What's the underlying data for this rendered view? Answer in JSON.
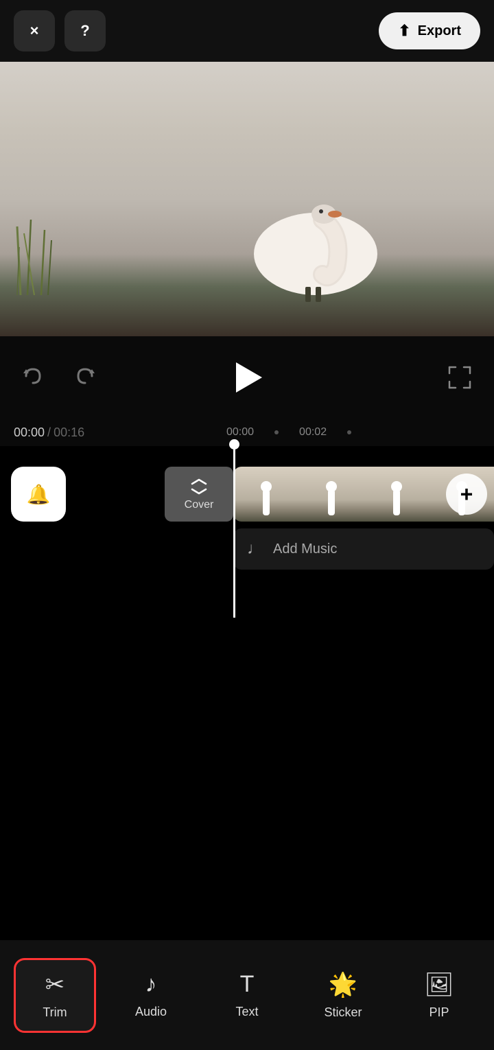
{
  "header": {
    "close_label": "×",
    "help_label": "?",
    "export_label": "Export"
  },
  "controls": {
    "undo_label": "↺",
    "redo_label": "↻",
    "play_label": "▶",
    "fullscreen_label": "⛶"
  },
  "timeline": {
    "current_time": "00:00",
    "total_time": "00:16",
    "marker_0": "00:00",
    "marker_2": "00:02",
    "cover_label": "Cover",
    "add_music_label": "Add Music",
    "add_clip_label": "+"
  },
  "toolbar": {
    "trim_label": "Trim",
    "audio_label": "Audio",
    "text_label": "Text",
    "sticker_label": "Sticker",
    "pip_label": "PIP"
  }
}
